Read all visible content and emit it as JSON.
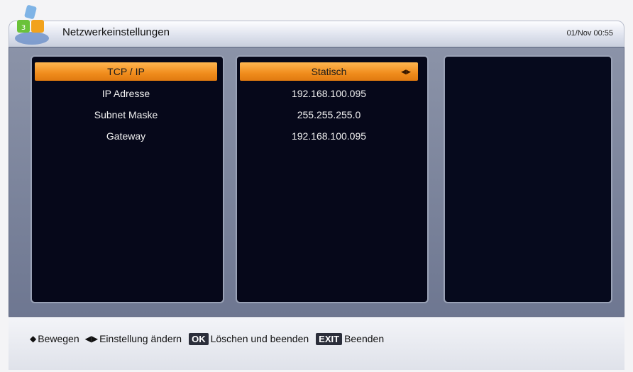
{
  "window": {
    "title": "Netzwerkeinstellungen",
    "clock": "01/Nov 00:55"
  },
  "settings": [
    {
      "label": "TCP / IP",
      "value": "Statisch",
      "selected": true
    },
    {
      "label": "IP Adresse",
      "value": "192.168.100.095",
      "selected": false
    },
    {
      "label": "Subnet Maske",
      "value": "255.255.255.0",
      "selected": false
    },
    {
      "label": "Gateway",
      "value": "192.168.100.095",
      "selected": false
    }
  ],
  "help": {
    "move_label": "Bewegen",
    "change_label": "Einstellung ändern",
    "ok_key": "OK",
    "ok_label": "Löschen und beenden",
    "exit_key": "EXIT",
    "exit_label": "Beenden"
  },
  "icons": {
    "up_down": "up-down-arrow-icon",
    "left_right": "left-right-arrow-icon",
    "logo": "app-logo-icon"
  },
  "colors": {
    "highlight": "#f08c1c",
    "panel": "#06081a",
    "frame": "#8b93a8"
  }
}
